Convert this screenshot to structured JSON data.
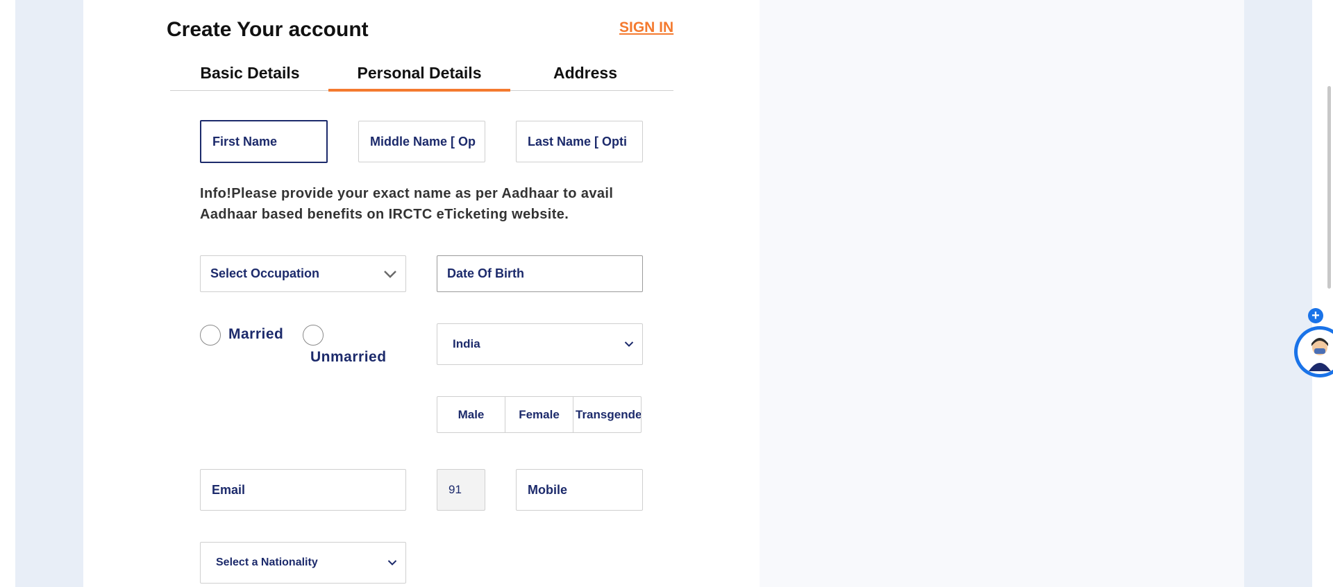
{
  "header": {
    "title": "Create Your account",
    "sign_in": "SIGN IN"
  },
  "tabs": [
    {
      "label": "Basic Details",
      "active": false
    },
    {
      "label": "Personal Details",
      "active": true
    },
    {
      "label": "Address",
      "active": false
    }
  ],
  "name": {
    "first_placeholder": "First Name",
    "middle_placeholder": "Middle Name  [ Op",
    "last_placeholder": "Last Name  [ Opti"
  },
  "info_text_line1": "Info!Please provide your exact name as per Aadhaar to avail",
  "info_text_line2": "Aadhaar based benefits on IRCTC eTicketing website.",
  "occupation": {
    "selected": "Select Occupation"
  },
  "dob": {
    "placeholder": "Date Of Birth"
  },
  "marital": {
    "married": "Married",
    "unmarried": "Unmarried"
  },
  "country": {
    "selected": "India"
  },
  "gender": {
    "options": [
      "Male",
      "Female",
      "Transgende"
    ]
  },
  "contact": {
    "email_placeholder": "Email",
    "country_code": "91",
    "mobile_placeholder": "Mobile"
  },
  "nationality": {
    "selected": "Select a Nationality"
  },
  "colors": {
    "accent": "#f47a2f",
    "navy": "#1c2a6b",
    "chat_blue": "#1a73e8"
  },
  "icons": [
    "chevron-down-icon",
    "plus-icon",
    "chatbot-avatar-icon"
  ]
}
